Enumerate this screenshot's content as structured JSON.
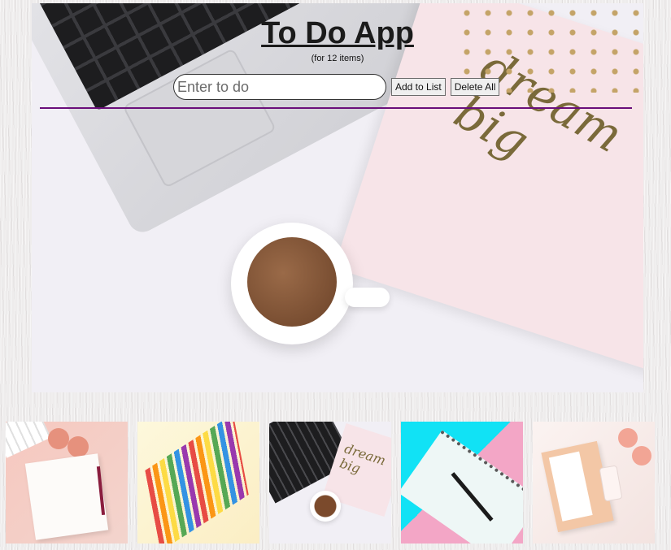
{
  "header": {
    "title": "To Do App",
    "subtitle": "(for 12 items)"
  },
  "form": {
    "input_placeholder": "Enter to do",
    "input_value": "",
    "add_label": "Add to List",
    "delete_label": "Delete All"
  },
  "hero": {
    "card_text": "dream big"
  },
  "thumbnails": [
    {
      "name": "pink-desk-notebook"
    },
    {
      "name": "colored-pencils"
    },
    {
      "name": "dream-big-laptop-coffee"
    },
    {
      "name": "cyan-pink-spiral-notebook"
    },
    {
      "name": "pink-planner-roses"
    }
  ],
  "colors": {
    "divider": "#6a0e7a",
    "title": "#1b1b1b",
    "input_border": "#333333"
  }
}
